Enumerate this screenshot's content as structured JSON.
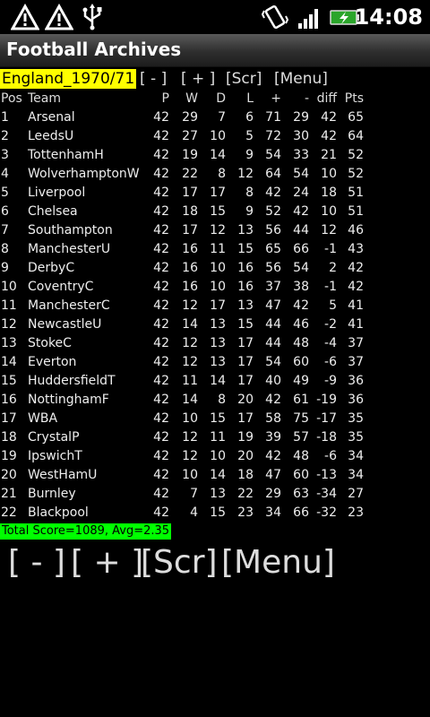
{
  "status_bar": {
    "icons": [
      "warning-icon",
      "warning-icon",
      "usb-icon",
      "vibrate-icon",
      "signal-icon",
      "battery-charging-icon"
    ],
    "time": "14:08"
  },
  "app": {
    "title": "Football Archives"
  },
  "controls": {
    "season": "England_1970/71",
    "minus": "[ - ]",
    "plus": "[ + ]",
    "scr": "[Scr]",
    "menu": "[Menu]"
  },
  "table": {
    "headers": [
      "Pos",
      "Team",
      "P",
      "W",
      "D",
      "L",
      "+",
      "-",
      "diff",
      "Pts"
    ],
    "rows": [
      [
        "1",
        "Arsenal",
        "42",
        "29",
        "7",
        "6",
        "71",
        "29",
        "42",
        "65"
      ],
      [
        "2",
        "LeedsU",
        "42",
        "27",
        "10",
        "5",
        "72",
        "30",
        "42",
        "64"
      ],
      [
        "3",
        "TottenhamH",
        "42",
        "19",
        "14",
        "9",
        "54",
        "33",
        "21",
        "52"
      ],
      [
        "4",
        "WolverhamptonW",
        "42",
        "22",
        "8",
        "12",
        "64",
        "54",
        "10",
        "52"
      ],
      [
        "5",
        "Liverpool",
        "42",
        "17",
        "17",
        "8",
        "42",
        "24",
        "18",
        "51"
      ],
      [
        "6",
        "Chelsea",
        "42",
        "18",
        "15",
        "9",
        "52",
        "42",
        "10",
        "51"
      ],
      [
        "7",
        "Southampton",
        "42",
        "17",
        "12",
        "13",
        "56",
        "44",
        "12",
        "46"
      ],
      [
        "8",
        "ManchesterU",
        "42",
        "16",
        "11",
        "15",
        "65",
        "66",
        "-1",
        "43"
      ],
      [
        "9",
        "DerbyC",
        "42",
        "16",
        "10",
        "16",
        "56",
        "54",
        "2",
        "42"
      ],
      [
        "10",
        "CoventryC",
        "42",
        "16",
        "10",
        "16",
        "37",
        "38",
        "-1",
        "42"
      ],
      [
        "11",
        "ManchesterC",
        "42",
        "12",
        "17",
        "13",
        "47",
        "42",
        "5",
        "41"
      ],
      [
        "12",
        "NewcastleU",
        "42",
        "14",
        "13",
        "15",
        "44",
        "46",
        "-2",
        "41"
      ],
      [
        "13",
        "StokeC",
        "42",
        "12",
        "13",
        "17",
        "44",
        "48",
        "-4",
        "37"
      ],
      [
        "14",
        "Everton",
        "42",
        "12",
        "13",
        "17",
        "54",
        "60",
        "-6",
        "37"
      ],
      [
        "15",
        "HuddersfieldT",
        "42",
        "11",
        "14",
        "17",
        "40",
        "49",
        "-9",
        "36"
      ],
      [
        "16",
        "NottinghamF",
        "42",
        "14",
        "8",
        "20",
        "42",
        "61",
        "-19",
        "36"
      ],
      [
        "17",
        "WBA",
        "42",
        "10",
        "15",
        "17",
        "58",
        "75",
        "-17",
        "35"
      ],
      [
        "18",
        "CrystalP",
        "42",
        "12",
        "11",
        "19",
        "39",
        "57",
        "-18",
        "35"
      ],
      [
        "19",
        "IpswichT",
        "42",
        "12",
        "10",
        "20",
        "42",
        "48",
        "-6",
        "34"
      ],
      [
        "20",
        "WestHamU",
        "42",
        "10",
        "14",
        "18",
        "47",
        "60",
        "-13",
        "34"
      ],
      [
        "21",
        "Burnley",
        "42",
        "7",
        "13",
        "22",
        "29",
        "63",
        "-34",
        "27"
      ],
      [
        "22",
        "Blackpool",
        "42",
        "4",
        "15",
        "23",
        "34",
        "66",
        "-32",
        "23"
      ]
    ]
  },
  "summary": {
    "total": "Total Score=1089, Avg=2.35"
  },
  "bottom_controls": {
    "minus": "[ - ]",
    "plus": "[ + ]",
    "scr": "[Scr]",
    "menu": "[Menu]"
  },
  "colors": {
    "season_bg": "#ffff00",
    "total_bg": "#00ff00",
    "background": "#000000"
  }
}
